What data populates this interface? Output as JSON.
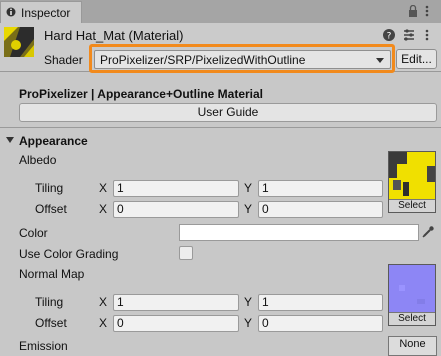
{
  "tab": {
    "title": "Inspector"
  },
  "header": {
    "material_name": "Hard Hat_Mat (Material)",
    "shader_label": "Shader",
    "shader_value": "ProPixelizer/SRP/PixelizedWithOutline",
    "edit_label": "Edit..."
  },
  "info": {
    "title": "ProPixelizer | Appearance+Outline Material",
    "guide_label": "User Guide"
  },
  "appearance": {
    "section_title": "Appearance",
    "albedo": {
      "label": "Albedo",
      "tiling_label": "Tiling",
      "tiling_x": "1",
      "tiling_y": "1",
      "offset_label": "Offset",
      "offset_x": "0",
      "offset_y": "0",
      "select_label": "Select"
    },
    "color_label": "Color",
    "use_color_grading_label": "Use Color Grading",
    "normal_map": {
      "label": "Normal Map",
      "tiling_label": "Tiling",
      "tiling_x": "1",
      "tiling_y": "1",
      "offset_label": "Offset",
      "offset_x": "0",
      "offset_y": "0",
      "select_label": "Select"
    },
    "emission_label": "Emission",
    "emission_value": "None"
  },
  "axes": {
    "x": "X",
    "y": "Y"
  },
  "colors": {
    "highlight": "#f28a1c",
    "normal_map": "#8d86f5",
    "albedo_yellow": "#f0e000"
  }
}
